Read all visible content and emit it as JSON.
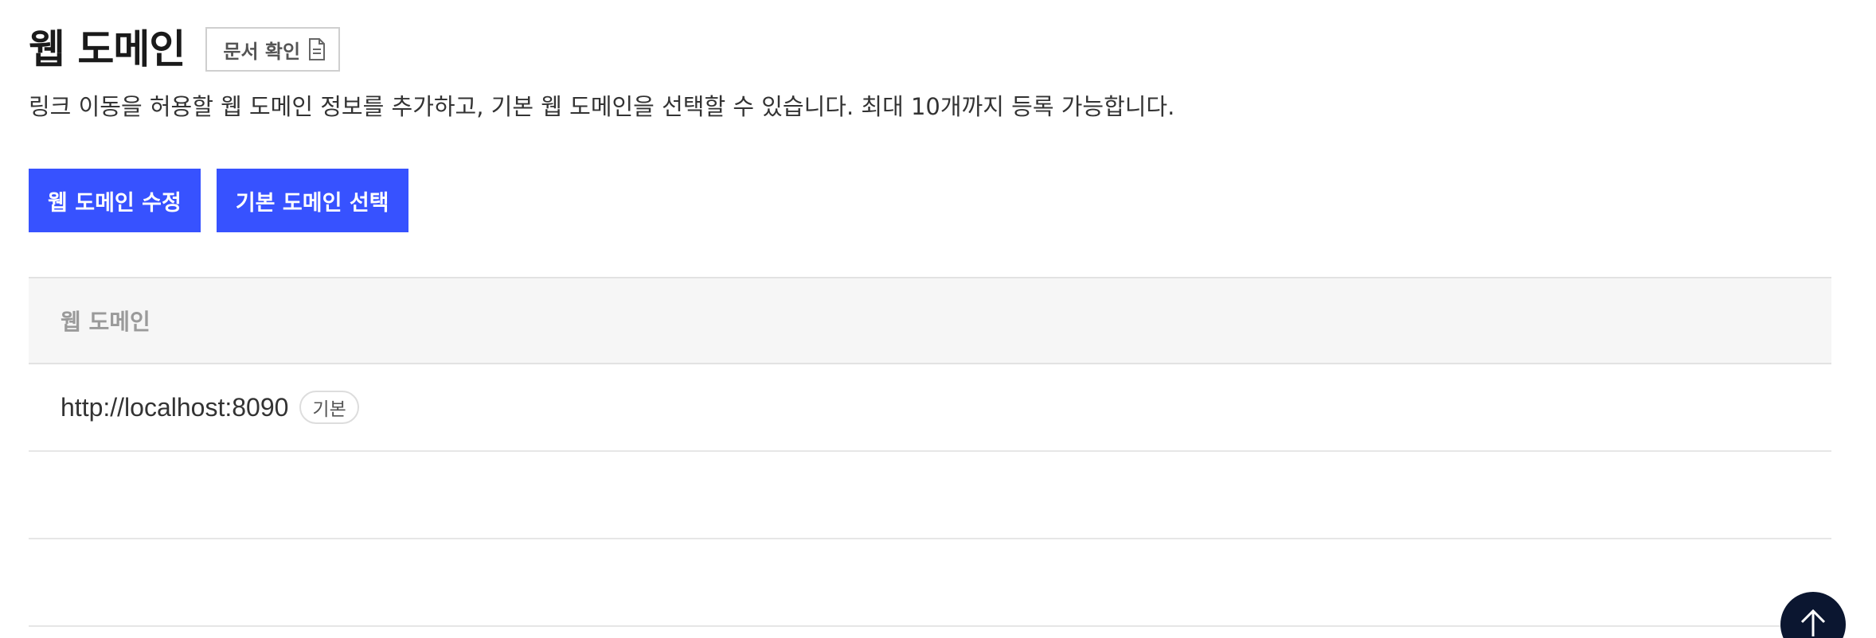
{
  "header": {
    "title": "웹 도메인",
    "doc_button_label": "문서 확인",
    "doc_icon": "document-icon"
  },
  "description": "링크 이동을 허용할 웹 도메인 정보를 추가하고, 기본 웹 도메인을 선택할 수 있습니다. 최대 10개까지 등록 가능합니다.",
  "actions": {
    "edit_label": "웹 도메인 수정",
    "select_default_label": "기본 도메인 선택"
  },
  "table": {
    "column_header": "웹 도메인",
    "rows": [
      {
        "domain": "http://localhost:8090",
        "badge": "기본"
      }
    ]
  },
  "scroll_top_icon": "arrow-up-icon",
  "colors": {
    "primary": "#3752ff",
    "scroll_button": "#0b1630"
  }
}
